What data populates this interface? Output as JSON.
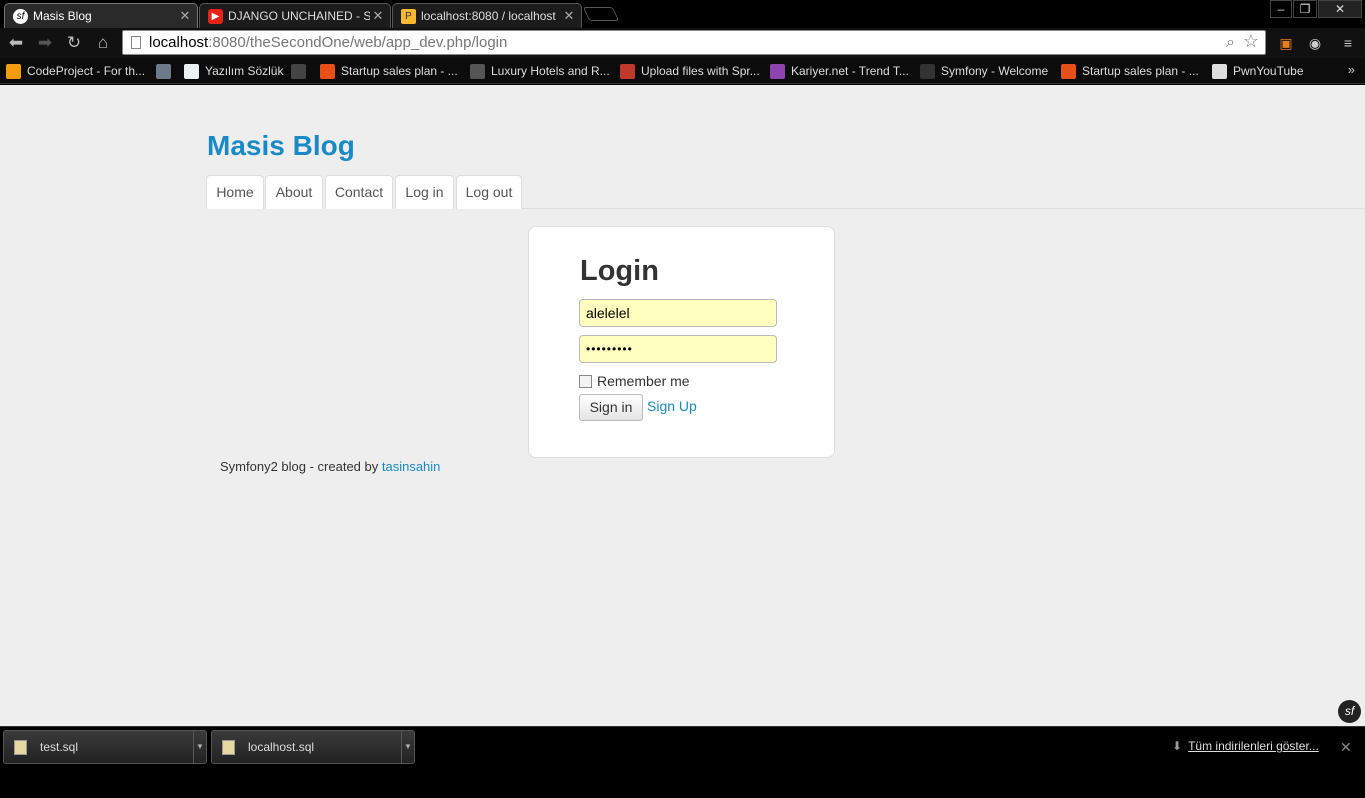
{
  "tabs": [
    {
      "title": "Masis Blog",
      "active": true
    },
    {
      "title": "DJANGO UNCHAINED - S",
      "active": false
    },
    {
      "title": "localhost:8080 / localhost",
      "active": false
    }
  ],
  "window_controls": {
    "minimize": "–",
    "restore": "❐",
    "close": "✕"
  },
  "toolbar": {
    "url_host": "localhost",
    "url_rest": ":8080/theSecondOne/web/app_dev.php/login"
  },
  "bookmarks": [
    {
      "label": "CodeProject - For th...",
      "color": "#f39c12"
    },
    {
      "label": "Yazılım Sözlük",
      "color": "#6c7a89"
    },
    {
      "label": "",
      "color": "#444"
    },
    {
      "label": "Startup sales plan - ...",
      "color": "#e8501a"
    },
    {
      "label": "Luxury Hotels and R...",
      "color": "#555"
    },
    {
      "label": "Upload files with Spr...",
      "color": "#c0392b"
    },
    {
      "label": "Kariyer.net - Trend T...",
      "color": "#8e44ad"
    },
    {
      "label": "Symfony - Welcome",
      "color": "#333"
    },
    {
      "label": "Startup sales plan - ...",
      "color": "#e8501a"
    },
    {
      "label": "PwnYouTube",
      "color": "#ddd"
    }
  ],
  "site": {
    "title": "Masis Blog",
    "nav": [
      "Home",
      "About",
      "Contact",
      "Log in",
      "Log out"
    ]
  },
  "login": {
    "heading": "Login",
    "username": "alelelel",
    "password": "•••••••••",
    "remember_label": "Remember me",
    "remember_checked": false,
    "signin_label": "Sign in",
    "signup_label": "Sign Up"
  },
  "footer": {
    "text": "Symfony2 blog - created by ",
    "author": "tasinsahin"
  },
  "downloads": [
    {
      "file": "test.sql"
    },
    {
      "file": "localhost.sql"
    }
  ],
  "show_all_downloads": "Tüm indirilenleri göster..."
}
